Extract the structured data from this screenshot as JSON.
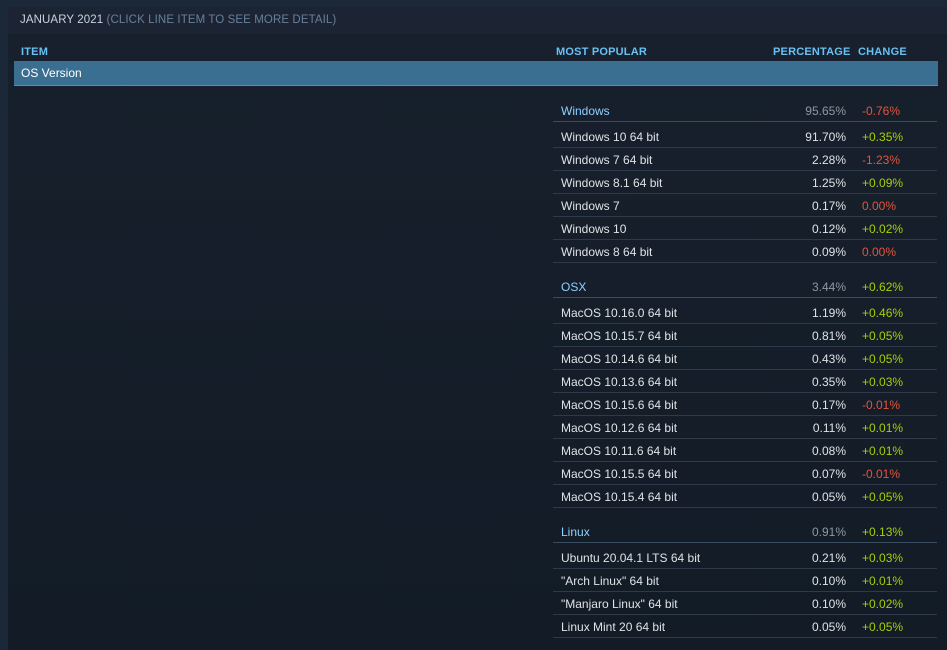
{
  "header": {
    "period": "JANUARY 2021",
    "hint": "(CLICK LINE ITEM TO SEE MORE DETAIL)"
  },
  "columns": {
    "item": "ITEM",
    "most_popular": "MOST POPULAR",
    "percentage": "PERCENTAGE",
    "change": "CHANGE"
  },
  "category": {
    "label": "OS Version"
  },
  "colors": {
    "positive": "#a4d007",
    "negative": "#e2553b",
    "group_label": "#8fd0ff",
    "category_bar": "#3a6f92"
  },
  "groups": [
    {
      "name": "Windows",
      "percentage": "95.65%",
      "change": "-0.76%",
      "items": [
        {
          "name": "Windows 10 64 bit",
          "percentage": "91.70%",
          "change": "+0.35%"
        },
        {
          "name": "Windows 7 64 bit",
          "percentage": "2.28%",
          "change": "-1.23%"
        },
        {
          "name": "Windows 8.1 64 bit",
          "percentage": "1.25%",
          "change": "+0.09%"
        },
        {
          "name": "Windows 7",
          "percentage": "0.17%",
          "change": "0.00%"
        },
        {
          "name": "Windows 10",
          "percentage": "0.12%",
          "change": "+0.02%"
        },
        {
          "name": "Windows 8 64 bit",
          "percentage": "0.09%",
          "change": "0.00%"
        }
      ]
    },
    {
      "name": "OSX",
      "percentage": "3.44%",
      "change": "+0.62%",
      "items": [
        {
          "name": "MacOS 10.16.0 64 bit",
          "percentage": "1.19%",
          "change": "+0.46%"
        },
        {
          "name": "MacOS 10.15.7 64 bit",
          "percentage": "0.81%",
          "change": "+0.05%"
        },
        {
          "name": "MacOS 10.14.6 64 bit",
          "percentage": "0.43%",
          "change": "+0.05%"
        },
        {
          "name": "MacOS 10.13.6 64 bit",
          "percentage": "0.35%",
          "change": "+0.03%"
        },
        {
          "name": "MacOS 10.15.6 64 bit",
          "percentage": "0.17%",
          "change": "-0.01%"
        },
        {
          "name": "MacOS 10.12.6 64 bit",
          "percentage": "0.11%",
          "change": "+0.01%"
        },
        {
          "name": "MacOS 10.11.6 64 bit",
          "percentage": "0.08%",
          "change": "+0.01%"
        },
        {
          "name": "MacOS 10.15.5 64 bit",
          "percentage": "0.07%",
          "change": "-0.01%"
        },
        {
          "name": "MacOS 10.15.4 64 bit",
          "percentage": "0.05%",
          "change": "+0.05%"
        }
      ]
    },
    {
      "name": "Linux",
      "percentage": "0.91%",
      "change": "+0.13%",
      "items": [
        {
          "name": "Ubuntu 20.04.1 LTS 64 bit",
          "percentage": "0.21%",
          "change": "+0.03%"
        },
        {
          "name": "\"Arch Linux\" 64 bit",
          "percentage": "0.10%",
          "change": "+0.01%"
        },
        {
          "name": "\"Manjaro Linux\" 64 bit",
          "percentage": "0.10%",
          "change": "+0.02%"
        },
        {
          "name": "Linux Mint 20 64 bit",
          "percentage": "0.05%",
          "change": "+0.05%"
        }
      ]
    }
  ]
}
